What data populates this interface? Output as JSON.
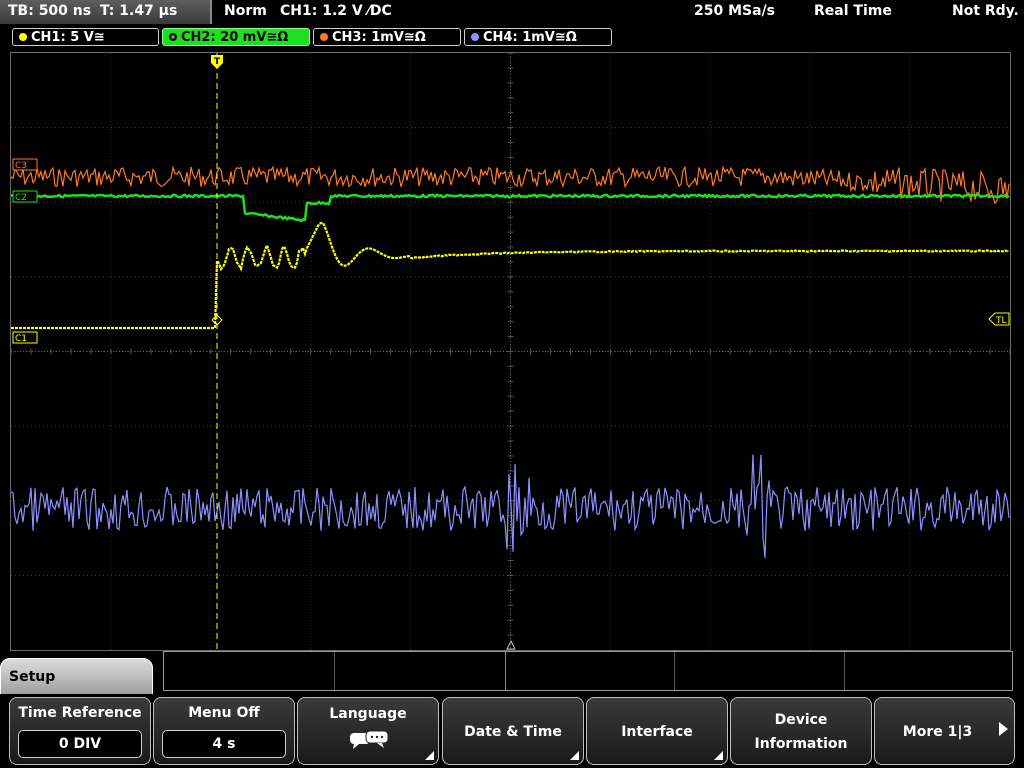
{
  "status_bar": {
    "timebase": "TB: 500 ns",
    "trigger_time": "T: 1.47 µs",
    "mode": "Norm",
    "trigger_source": "CH1: 1.2 V ⁄DC",
    "sample_rate": "250 MSa/s",
    "acquisition": "Real Time",
    "state": "Not Rdy."
  },
  "channels": [
    {
      "label": "CH1: 5 V≅",
      "color": "#ffff00",
      "active": false
    },
    {
      "label": "CH2: 20 mV≅Ω",
      "color": "#1ee01e",
      "active": true
    },
    {
      "label": "CH3: 1mV≅Ω",
      "color": "#ff7a20",
      "active": false
    },
    {
      "label": "CH4: 1mV≅Ω",
      "color": "#8f8fff",
      "active": false
    }
  ],
  "markers": {
    "c1": "C1",
    "c2": "C2",
    "c3": "C3",
    "trigger_level": "TL",
    "trigger_pos": "T"
  },
  "menu_title": "Setup",
  "softkeys": {
    "time_reference": {
      "label": "Time Reference",
      "value": "0 DIV"
    },
    "menu_off": {
      "label": "Menu Off",
      "value": "4 s"
    },
    "language": {
      "label": "Language",
      "icon": "speech-bubbles-icon"
    },
    "date_time": {
      "label": "Date & Time"
    },
    "interface": {
      "label": "Interface"
    },
    "device_information": {
      "label_line1": "Device",
      "label_line2": "Information"
    },
    "more": {
      "label": "More 1|3"
    }
  }
}
